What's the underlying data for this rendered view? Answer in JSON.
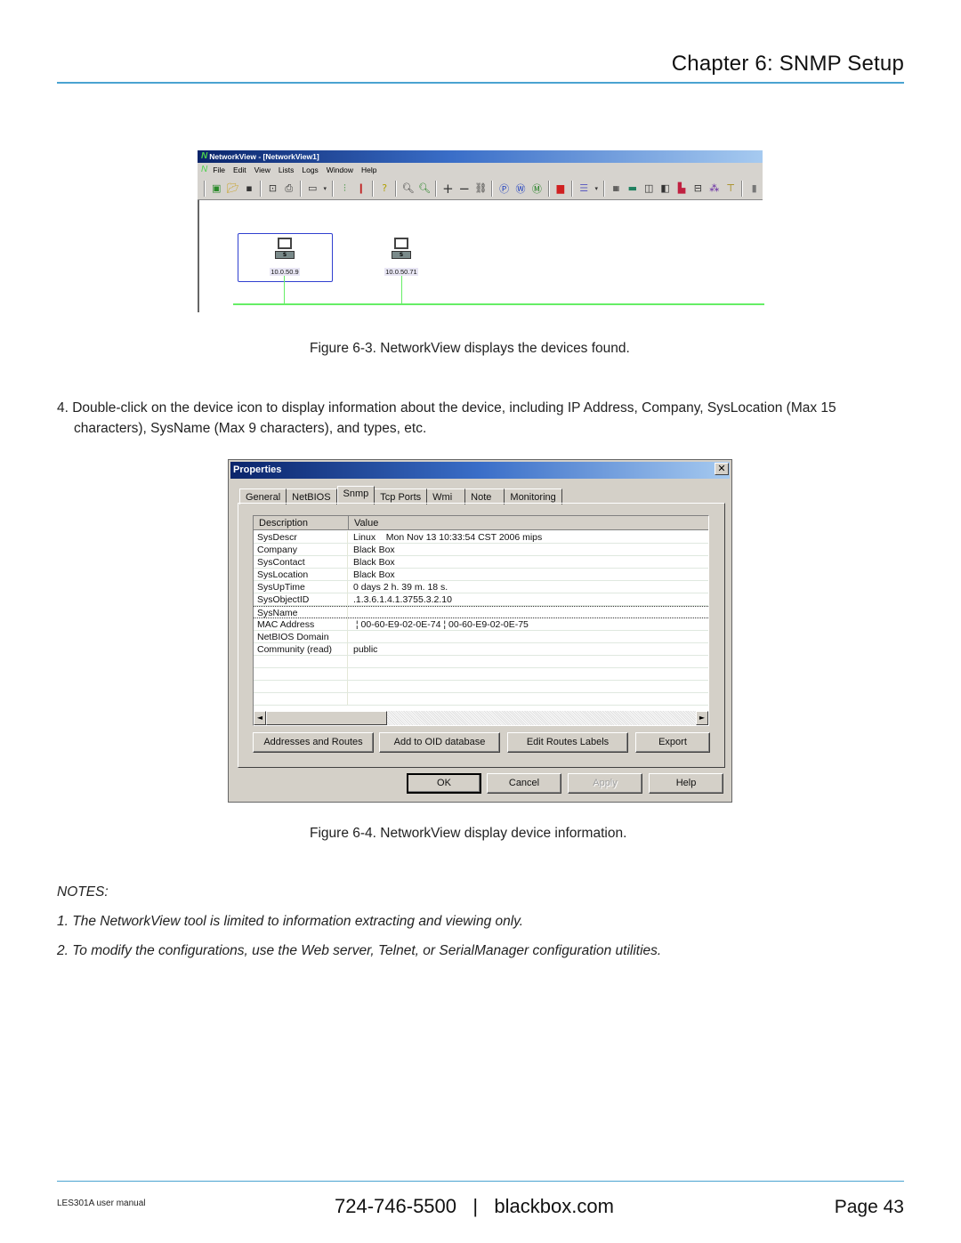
{
  "header": {
    "chapter_title": "Chapter 6: SNMP Setup"
  },
  "figure_3": {
    "window": {
      "title": "NetworkView - [NetworkView1]",
      "menu": [
        "File",
        "Edit",
        "View",
        "Lists",
        "Logs",
        "Window",
        "Help"
      ],
      "toolbar_icons": [
        "new-map-icon",
        "open-folder-icon",
        "save-icon",
        "print-preview-icon",
        "print-icon",
        "window-icon",
        "dropdown-icon",
        "device-props-icon",
        "tool-icon",
        "help-icon",
        "zoom-in-icon",
        "zoom-reset-icon",
        "add-icon",
        "remove-icon",
        "find-icon",
        "ping-icon",
        "web-icon",
        "monitor-icon",
        "alert-icon",
        "list-view-icon",
        "dropdown-icon",
        "mib-icon",
        "network-card-icon",
        "book-icon",
        "book-open-icon",
        "factory-icon",
        "computer-icon",
        "users-icon",
        "tree-icon",
        "stop-icon"
      ],
      "devices": [
        {
          "ip": "10.0.50.9",
          "selected": true,
          "badge": "S"
        },
        {
          "ip": "10.0.50.71",
          "selected": false,
          "badge": "S"
        }
      ]
    },
    "caption": "Figure 6-3. NetworkView displays the devices found."
  },
  "step_4": "4. Double-click on the device icon to display information about the device, including IP Address, Company, SysLocation (Max 15 characters), SysName (Max 9 characters), and types, etc.",
  "figure_4": {
    "dialog": {
      "title": "Properties",
      "close_glyph": "✕",
      "tabs": [
        "General",
        "NetBIOS",
        "Snmp",
        "Tcp Ports",
        "Wmi",
        "Note",
        "Monitoring"
      ],
      "active_tab": "Snmp",
      "columns": [
        "Description",
        "Value"
      ],
      "rows": [
        {
          "description": "SysDescr",
          "value": "Linux    Mon Nov 13 10:33:54 CST 2006 mips"
        },
        {
          "description": "Company",
          "value": "Black Box"
        },
        {
          "description": "SysContact",
          "value": "Black Box"
        },
        {
          "description": "SysLocation",
          "value": "Black Box"
        },
        {
          "description": "SysUpTime",
          "value": "0 days 2 h. 39 m. 18 s."
        },
        {
          "description": "SysObjectID",
          "value": ".1.3.6.1.4.1.3755.3.2.10"
        },
        {
          "description": "SysName",
          "value": ""
        },
        {
          "description": "MAC Address",
          "value": " ¦ 00-60-E9-02-0E-74 ¦ 00-60-E9-02-0E-75"
        },
        {
          "description": "NetBIOS Domain",
          "value": ""
        },
        {
          "description": "Community (read)",
          "value": "public"
        }
      ],
      "scroll_left": "◄",
      "scroll_right": "►",
      "action_buttons": [
        "Addresses and Routes",
        "Add to OID database",
        "Edit Routes Labels",
        "Export"
      ],
      "footer_buttons": {
        "ok": "OK",
        "cancel": "Cancel",
        "apply": "Apply",
        "help": "Help"
      }
    },
    "caption": "Figure 6-4. NetworkView display device information."
  },
  "notes": {
    "heading": "NOTES:",
    "items": [
      "1. The NetworkView tool is limited to information extracting and viewing only.",
      "2. To modify the configurations, use the Web server, Telnet, or SerialManager configuration utilities."
    ]
  },
  "footer": {
    "manual": "LES301A user manual",
    "contact": "724-746-5500   |   blackbox.com",
    "page": "Page 43"
  },
  "colors": {
    "rule": "#4aa3d1",
    "titlebar_start": "#0a246a",
    "titlebar_end": "#a6caf0",
    "network_line": "#66ee66"
  }
}
